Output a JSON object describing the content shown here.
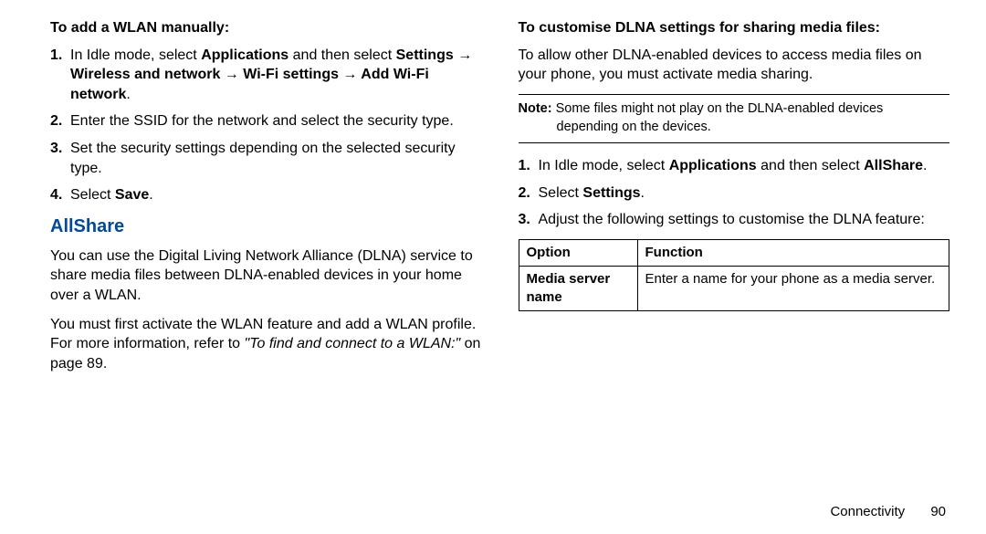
{
  "left": {
    "h1": "To add a WLAN manually:",
    "steps": [
      {
        "pre": "In Idle mode, select ",
        "b1": "Applications",
        "mid1": " and then select ",
        "b2": "Settings → Wireless and network → Wi-Fi settings → Add Wi-Fi network",
        "post": "."
      },
      {
        "text": "Enter the SSID for the network and select the security type."
      },
      {
        "text": "Set the security settings depending on the selected security type."
      },
      {
        "pre": "Select ",
        "b1": "Save",
        "post": "."
      }
    ],
    "section": "AllShare",
    "p1": "You can use the Digital Living Network Alliance (DLNA) service to share media files between DLNA-enabled devices in your home over a WLAN.",
    "p2_a": "You must first activate the WLAN feature and add a WLAN profile. For more information, refer to ",
    "p2_i": "\"To find and connect to a WLAN:\"",
    "p2_b": "  on page 89."
  },
  "right": {
    "h1": "To customise DLNA settings for sharing media files:",
    "p1": "To allow other DLNA-enabled devices to access media files on your phone, you must activate media sharing.",
    "note_label": "Note:",
    "note_a": " Some files might not play on the DLNA-enabled devices",
    "note_b": "depending on the devices.",
    "steps": [
      {
        "pre": "In Idle mode, select ",
        "b1": "Applications",
        "mid1": " and then select ",
        "b2": "AllShare",
        "post": "."
      },
      {
        "pre": "Select ",
        "b1": "Settings",
        "post": "."
      },
      {
        "text": "Adjust the following settings to customise the DLNA feature:"
      }
    ],
    "table": {
      "h1": "Option",
      "h2": "Function",
      "r1c1": "Media server name",
      "r1c2": "Enter a name for your phone as a media server."
    }
  },
  "footer": {
    "section": "Connectivity",
    "page": "90"
  }
}
